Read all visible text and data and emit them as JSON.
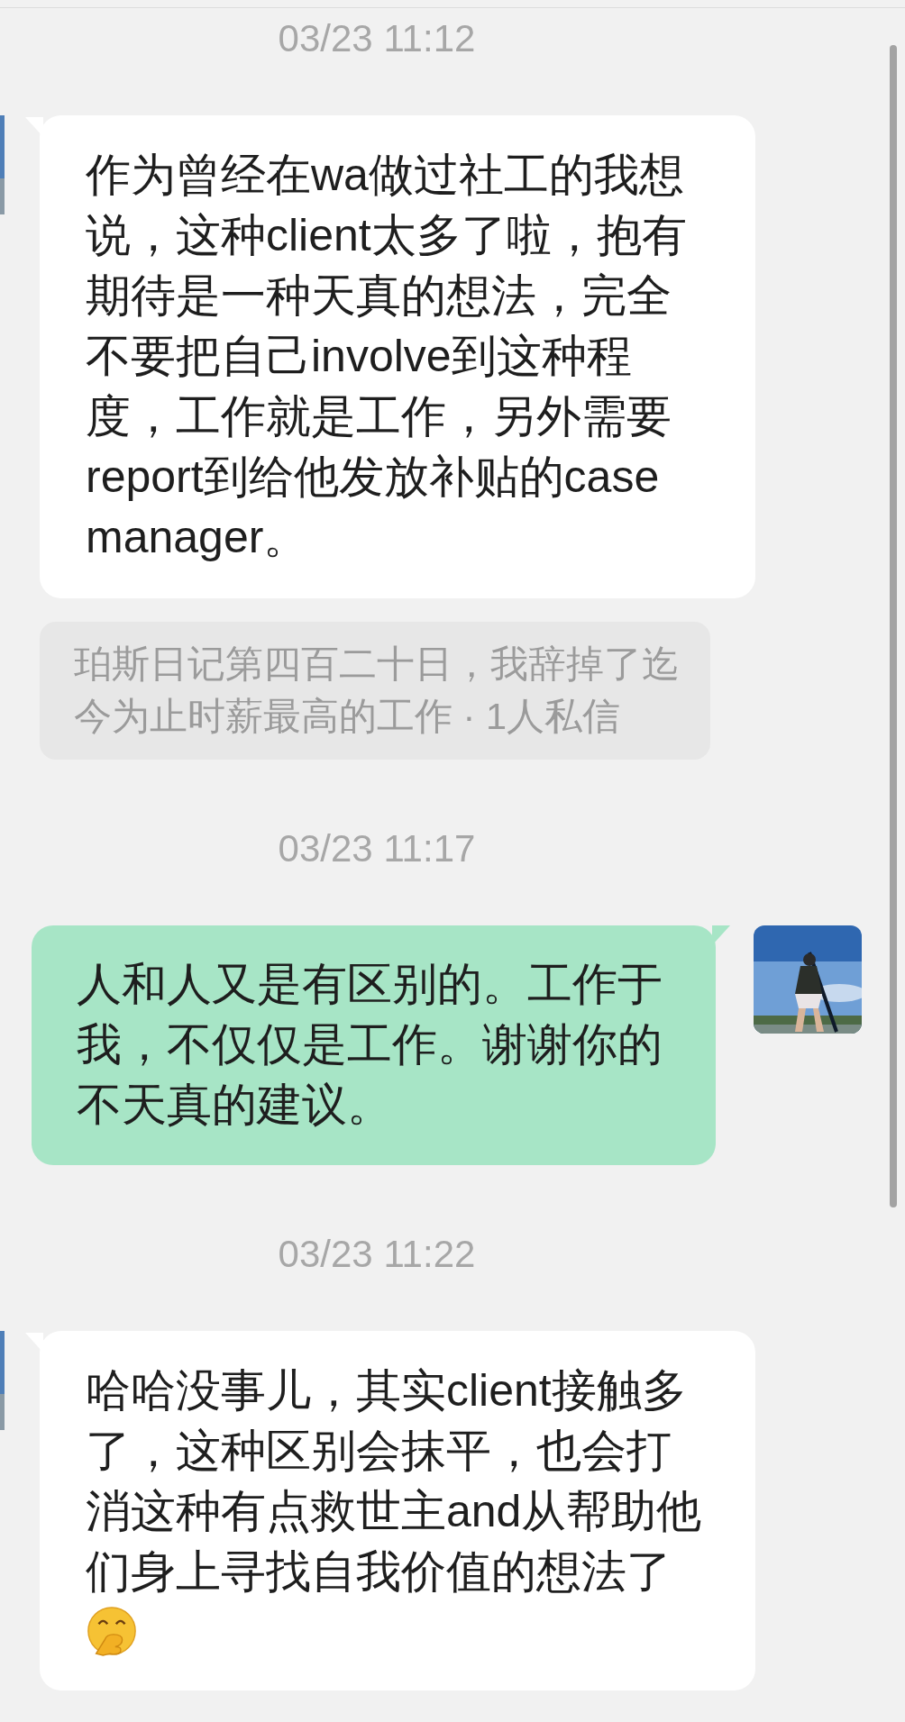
{
  "messages": [
    {
      "kind": "timestamp",
      "text": "03/23 11:12"
    },
    {
      "kind": "received",
      "text": "作为曾经在wa做过社工的我想说，这种client太多了啦，抱有期待是一种天真的想法，完全不要把自己involve到这种程度，工作就是工作，另外需要report到给他发放补贴的case manager。",
      "emoji": false
    },
    {
      "kind": "quote",
      "text": "珀斯日记第四百二十日，我辞掉了迄今为止时薪最高的工作 · 1人私信"
    },
    {
      "kind": "timestamp",
      "text": "03/23 11:17"
    },
    {
      "kind": "sent",
      "text": "人和人又是有区别的。工作于我，不仅仅是工作。谢谢你的不天真的建议。",
      "emoji": false
    },
    {
      "kind": "timestamp",
      "text": "03/23 11:22"
    },
    {
      "kind": "received",
      "text": "哈哈没事儿，其实client接触多了，这种区别会抹平，也会打消这种有点救世主and从帮助他们身上寻找自我价值的想法了",
      "emoji": true
    }
  ]
}
